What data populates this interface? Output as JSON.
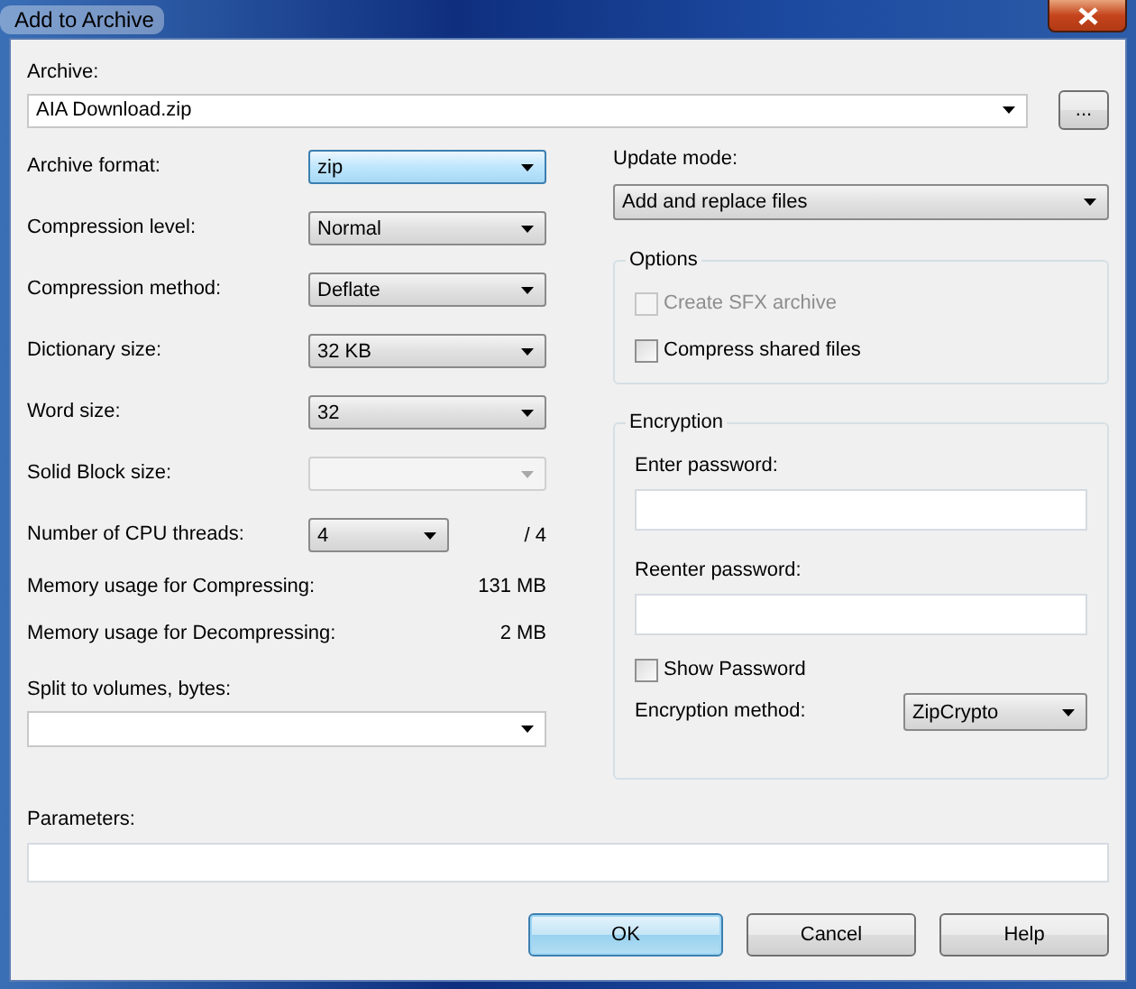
{
  "window": {
    "title": "Add to Archive"
  },
  "archive": {
    "label": "Archive:",
    "value": "AIA Download.zip",
    "browse_button": "..."
  },
  "settings": [
    {
      "label": "Archive format:",
      "value": "zip",
      "focused": true,
      "disabled": false
    },
    {
      "label": "Compression level:",
      "value": "Normal",
      "focused": false,
      "disabled": false
    },
    {
      "label": "Compression method:",
      "value": "Deflate",
      "focused": false,
      "disabled": false
    },
    {
      "label": "Dictionary size:",
      "value": "32 KB",
      "focused": false,
      "disabled": false
    },
    {
      "label": "Word size:",
      "value": "32",
      "focused": false,
      "disabled": false
    },
    {
      "label": "Solid Block size:",
      "focused": false,
      "disabled": true
    },
    {
      "label": "Number of CPU threads:",
      "value": "4",
      "suffix": "/ 4",
      "focused": false,
      "disabled": false
    }
  ],
  "memory": [
    {
      "label": "Memory usage for Compressing:",
      "value": "131 MB"
    },
    {
      "label": "Memory usage for Decompressing:",
      "value": "2 MB"
    }
  ],
  "split": {
    "label": "Split to volumes, bytes:"
  },
  "update_mode": {
    "label": "Update mode:",
    "value": "Add and replace files"
  },
  "options": {
    "title": "Options",
    "checkboxes": [
      {
        "label": "Create SFX archive",
        "checked": false,
        "disabled": true
      },
      {
        "label": "Compress shared files",
        "checked": false,
        "disabled": false
      }
    ]
  },
  "encryption": {
    "title": "Encryption",
    "fields": [
      {
        "label": "Enter password:"
      },
      {
        "label": "Reenter password:"
      }
    ],
    "show_password": {
      "label": "Show Password",
      "checked": false
    },
    "method": {
      "label": "Encryption method:",
      "value": "ZipCrypto"
    }
  },
  "parameters": {
    "label": "Parameters:"
  },
  "buttons": [
    {
      "label": "OK",
      "default": true
    },
    {
      "label": "Cancel",
      "default": false
    },
    {
      "label": "Help",
      "default": false
    }
  ]
}
